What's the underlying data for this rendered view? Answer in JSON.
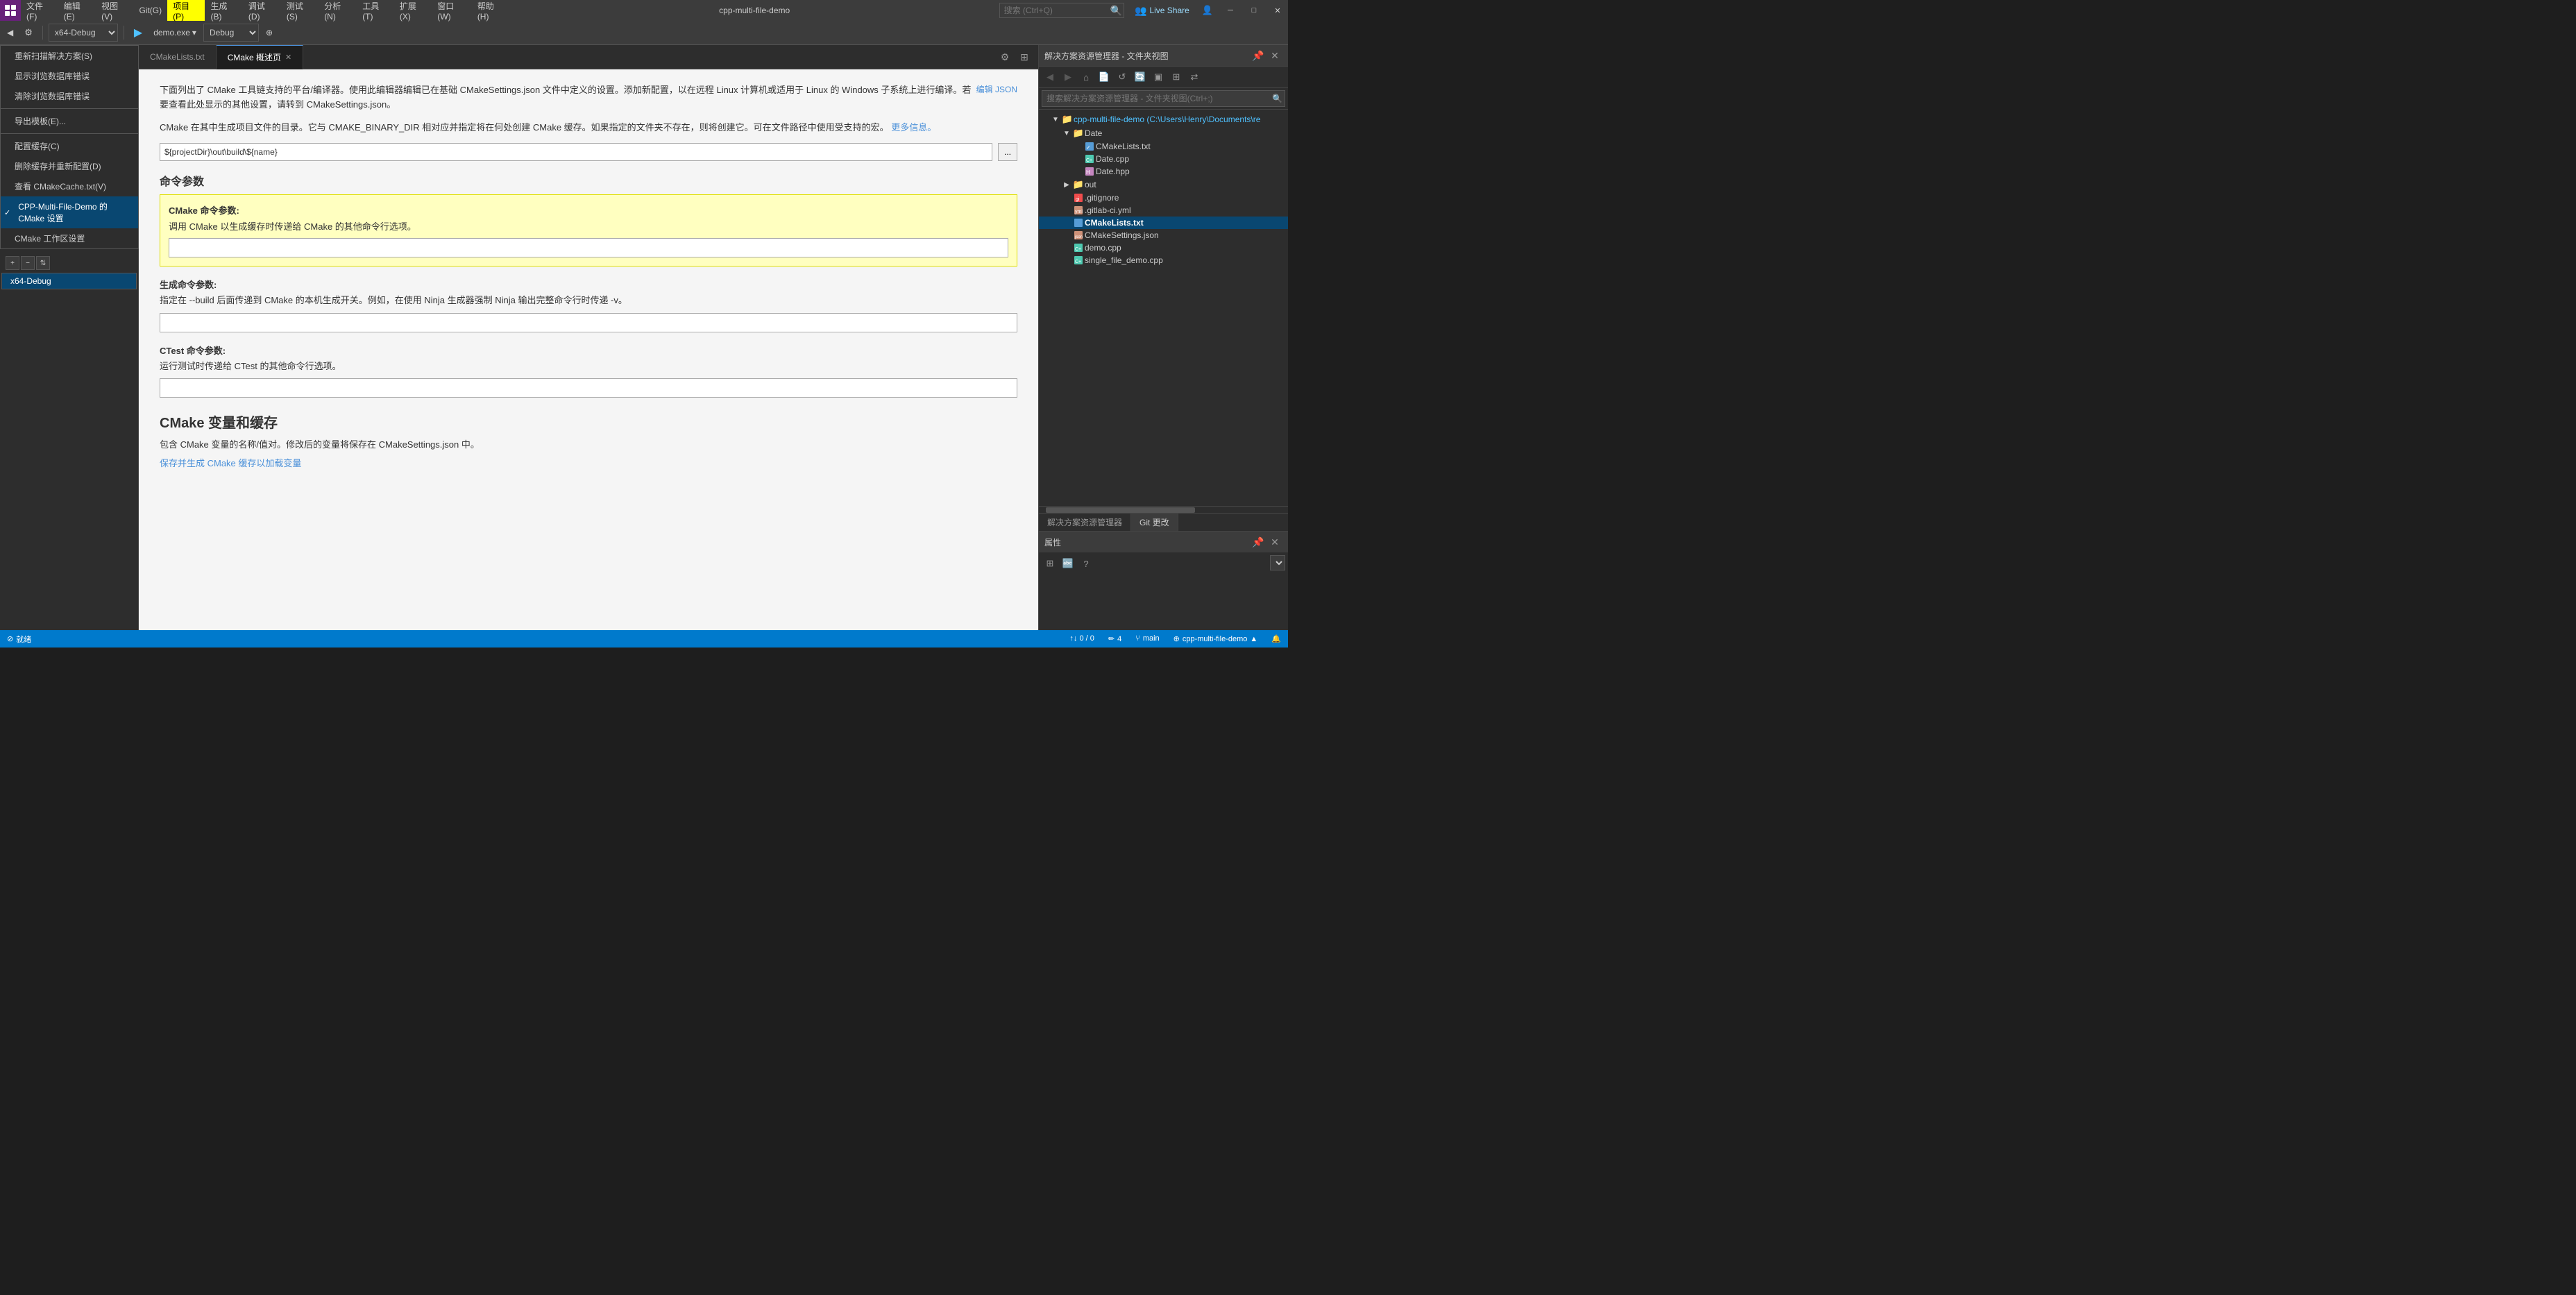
{
  "titlebar": {
    "menus": [
      {
        "id": "file",
        "label": "文件(F)"
      },
      {
        "id": "edit",
        "label": "编辑(E)"
      },
      {
        "id": "view",
        "label": "视图(V)"
      },
      {
        "id": "git",
        "label": "Git(G)"
      },
      {
        "id": "project",
        "label": "项目(P)",
        "active": true
      },
      {
        "id": "build",
        "label": "生成(B)"
      },
      {
        "id": "debug",
        "label": "调试(D)"
      },
      {
        "id": "test",
        "label": "测试(S)"
      },
      {
        "id": "analyze",
        "label": "分析(N)"
      },
      {
        "id": "tools",
        "label": "工具(T)"
      },
      {
        "id": "extensions",
        "label": "扩展(X)"
      },
      {
        "id": "window",
        "label": "窗口(W)"
      },
      {
        "id": "help",
        "label": "帮助(H)"
      }
    ],
    "search_placeholder": "搜索 (Ctrl+Q)",
    "app_title": "cpp-multi-file-demo",
    "live_share": "Live Share"
  },
  "toolbar": {
    "platform": "x64-Debug",
    "exe": "demo.exe",
    "debug_mode": "Debug"
  },
  "context_menu": {
    "items": [
      {
        "id": "rescan",
        "label": "重新扫描解决方案(S)"
      },
      {
        "id": "show_db_errors",
        "label": "显示浏览数据库错误"
      },
      {
        "id": "clear_db_errors",
        "label": "清除浏览数据库错误"
      },
      {
        "id": "separator1"
      },
      {
        "id": "export_template",
        "label": "导出模板(E)..."
      },
      {
        "id": "separator2"
      },
      {
        "id": "config_cache",
        "label": "配置缓存(C)"
      },
      {
        "id": "delete_cache",
        "label": "删除缓存并重新配置(D)"
      },
      {
        "id": "view_cmake_cache",
        "label": "查看 CMakeCache.txt(V)"
      },
      {
        "id": "cmake_settings",
        "label": "CPP-Multi-File-Demo 的 CMake 设置",
        "highlighted": true
      },
      {
        "id": "cmake_workspace",
        "label": "CMake 工作区设置"
      }
    ],
    "config_items": [
      {
        "id": "x64debug",
        "label": "x64-Debug",
        "selected": true
      }
    ]
  },
  "tabs": [
    {
      "id": "cmakelists",
      "label": "CMakeLists.txt"
    },
    {
      "id": "cmake_overview",
      "label": "CMake 概述页",
      "active": true
    }
  ],
  "content": {
    "edit_json_link": "编辑 JSON",
    "intro_text": "下面列出了 CMake 工具链支持的平台/编译器。使用此编辑器编辑已在基础 CMakeSettings.json 文件中定义的设置。添加新配置，以在远程 Linux 计算机或适用于 Linux 的 Windows 子系统上进行编译。若要查看此处显示的其他设置，请转到 CMakeSettings.json。",
    "build_dir_label": "CMake 在其中生成项目文件的目录。它与 CMAKE_BINARY_DIR 相对应并指定将在何处创建 CMake 缓存。如果指定的文件夹不存在，则将创建它。可在文件路径中使用受支持的宏。",
    "more_info_link": "更多信息。",
    "build_dir_value": "${projectDir}\\out\\build\\${name}",
    "browse_btn": "...",
    "cmd_params_section": "命令参数",
    "cmake_cmd_label": "CMake 命令参数:",
    "cmake_cmd_desc": "调用 CMake 以生成缓存时传递给 CMake 的其他命令行选项。",
    "cmake_cmd_value": "",
    "build_cmd_label": "生成命令参数:",
    "build_cmd_desc": "指定在 --build 后面传递到 CMake 的本机生成开关。例如，在使用 Ninja 生成器强制 Ninja 输出完整命令行时传递 -v。",
    "build_cmd_value": "",
    "ctest_cmd_label": "CTest 命令参数:",
    "ctest_cmd_desc": "运行测试时传递给 CTest 的其他命令行选项。",
    "ctest_cmd_value": "",
    "variables_section": "CMake 变量和缓存",
    "variables_desc": "包含 CMake 变量的名称/值对。修改后的变量将保存在 CMakeSettings.json 中。",
    "save_link": "保存并生成 CMake 缓存以加载变量"
  },
  "solution_explorer": {
    "title": "解决方案资源管理器 - 文件夹视图",
    "search_placeholder": "搜索解决方案资源管理器 - 文件夹视图(Ctrl+;)",
    "tree": {
      "root": "cpp-multi-file-demo (C:\\Users\\Henry\\Documents\\re",
      "items": [
        {
          "id": "date_folder",
          "label": "Date",
          "type": "folder",
          "indent": 1,
          "expanded": true
        },
        {
          "id": "cmakelists_date",
          "label": "CMakeLists.txt",
          "type": "cmake",
          "indent": 2
        },
        {
          "id": "date_cpp",
          "label": "Date.cpp",
          "type": "cpp",
          "indent": 2
        },
        {
          "id": "date_hpp",
          "label": "Date.hpp",
          "type": "h",
          "indent": 2
        },
        {
          "id": "out_folder",
          "label": "out",
          "type": "folder",
          "indent": 1,
          "expanded": false
        },
        {
          "id": "gitignore",
          "label": ".gitignore",
          "type": "git",
          "indent": 1
        },
        {
          "id": "gitlab_ci",
          "label": ".gitlab-ci.yml",
          "type": "yml",
          "indent": 1
        },
        {
          "id": "cmakelists_root",
          "label": "CMakeLists.txt",
          "type": "cmake",
          "indent": 1,
          "bold": true
        },
        {
          "id": "cmake_settings",
          "label": "CMakeSettings.json",
          "type": "json",
          "indent": 1
        },
        {
          "id": "demo_cpp",
          "label": "demo.cpp",
          "type": "cpp",
          "indent": 1
        },
        {
          "id": "single_file_demo",
          "label": "single_file_demo.cpp",
          "type": "cpp",
          "indent": 1
        }
      ]
    },
    "bottom_tabs": [
      {
        "id": "solution_explorer",
        "label": "解决方案资源管理器"
      },
      {
        "id": "git_changes",
        "label": "Git 更改",
        "active": true
      }
    ],
    "properties": {
      "title": "属性"
    }
  },
  "statusbar": {
    "status": "就绪",
    "line_col": "↑↓ 0 / 0",
    "errors": "4",
    "branch": "main",
    "project": "cpp-multi-file-demo",
    "notifications": "🔔"
  },
  "icons": {
    "search": "🔍",
    "play": "▶",
    "folder": "📁",
    "cmake": "📄",
    "cpp": "📄",
    "h": "📄",
    "json": "📄",
    "git": "📄",
    "arrow_right": "▶",
    "arrow_down": "▼"
  }
}
